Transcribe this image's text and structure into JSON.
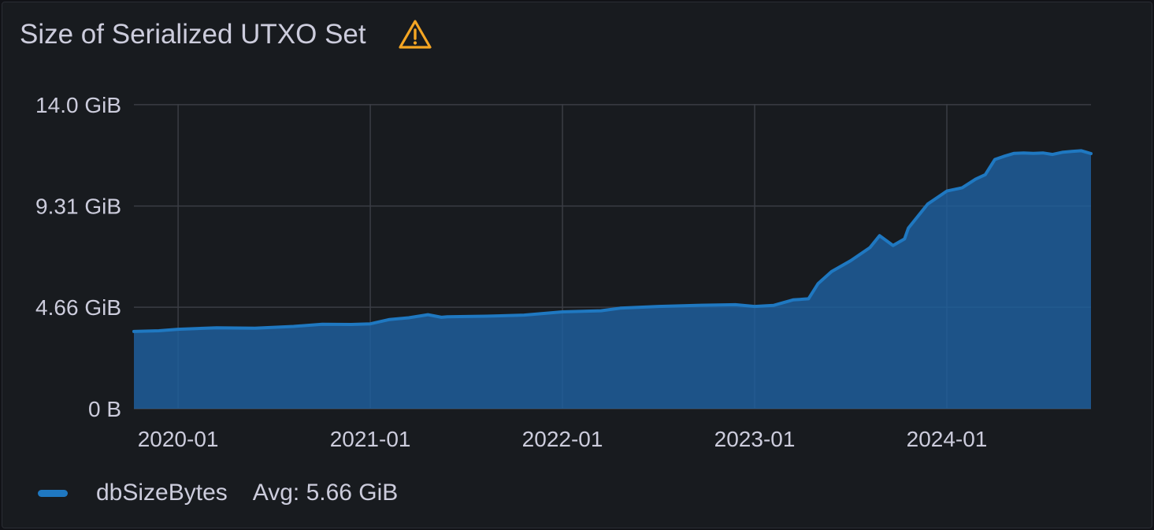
{
  "panel": {
    "title": "Size of Serialized UTXO Set",
    "warning_icon": "warning-triangle-icon"
  },
  "colors": {
    "background": "#181b1f",
    "series_line": "#1f78c1",
    "series_fill": "#1f60a0",
    "grid": "#3a3d44",
    "text": "#ccccdc",
    "warning": "#f5a623"
  },
  "legend": {
    "series_name": "dbSizeBytes",
    "stat": "Avg: 5.66 GiB"
  },
  "chart_data": {
    "type": "area",
    "title": "Size of Serialized UTXO Set",
    "xlabel": "",
    "ylabel": "",
    "ylim": [
      0,
      14.0
    ],
    "y_unit": "GiB",
    "grid": true,
    "legend_placement": "bottom-left",
    "yticks": [
      {
        "value": 0,
        "label": "0 B"
      },
      {
        "value": 4.66,
        "label": "4.66 GiB"
      },
      {
        "value": 9.31,
        "label": "9.31 GiB"
      },
      {
        "value": 13.97,
        "label": "14.0 GiB"
      }
    ],
    "xticks": [
      "2020-01",
      "2021-01",
      "2022-01",
      "2023-01",
      "2024-01"
    ],
    "xlim": [
      2019.77,
      2024.75
    ],
    "series": [
      {
        "name": "dbSizeBytes",
        "x": [
          2019.77,
          2019.9,
          2020.0,
          2020.2,
          2020.4,
          2020.6,
          2020.75,
          2020.9,
          2021.0,
          2021.1,
          2021.2,
          2021.3,
          2021.37,
          2021.4,
          2021.6,
          2021.8,
          2022.0,
          2022.2,
          2022.3,
          2022.5,
          2022.7,
          2022.9,
          2023.0,
          2023.1,
          2023.2,
          2023.28,
          2023.33,
          2023.4,
          2023.5,
          2023.6,
          2023.65,
          2023.72,
          2023.78,
          2023.8,
          2023.9,
          2024.0,
          2024.08,
          2024.15,
          2024.2,
          2024.25,
          2024.3,
          2024.35,
          2024.4,
          2024.45,
          2024.5,
          2024.55,
          2024.6,
          2024.65,
          2024.7,
          2024.75
        ],
        "values": [
          3.55,
          3.58,
          3.65,
          3.72,
          3.7,
          3.78,
          3.88,
          3.87,
          3.9,
          4.1,
          4.18,
          4.32,
          4.2,
          4.22,
          4.25,
          4.3,
          4.45,
          4.5,
          4.62,
          4.7,
          4.75,
          4.78,
          4.7,
          4.75,
          5.0,
          5.05,
          5.75,
          6.3,
          6.8,
          7.4,
          7.95,
          7.5,
          7.8,
          8.3,
          9.4,
          10.0,
          10.15,
          10.55,
          10.75,
          11.45,
          11.6,
          11.73,
          11.75,
          11.73,
          11.75,
          11.68,
          11.78,
          11.82,
          11.85,
          11.72
        ]
      }
    ]
  }
}
